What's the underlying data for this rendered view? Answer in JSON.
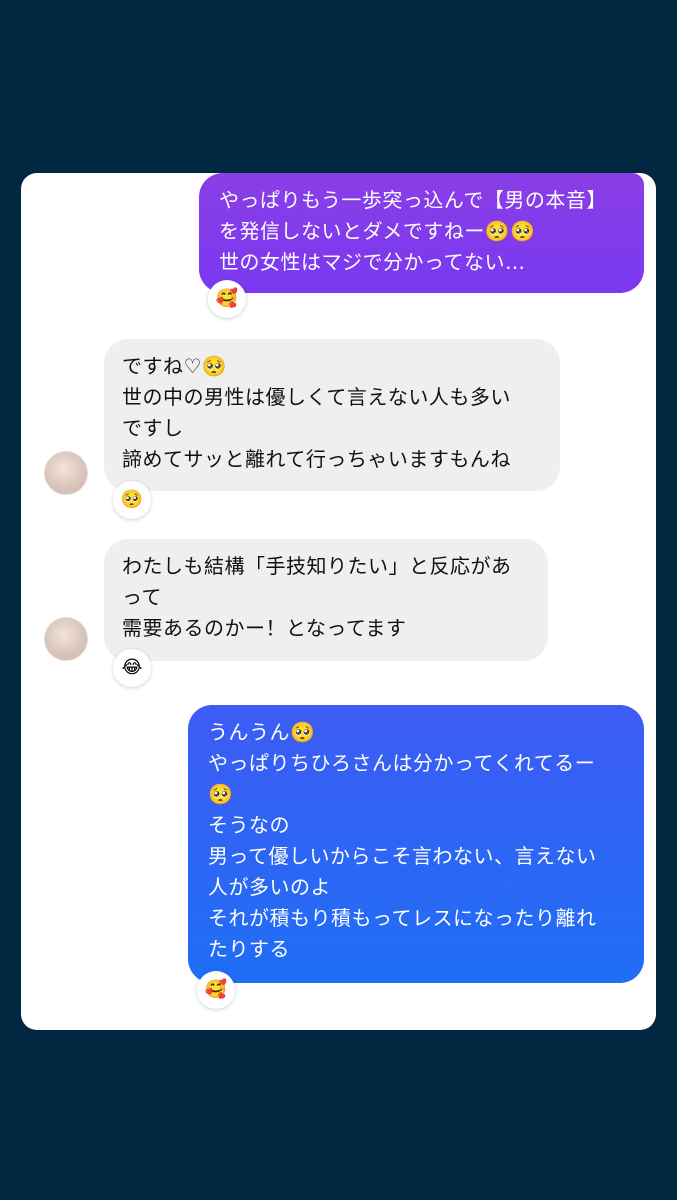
{
  "messages": [
    {
      "direction": "outgoing",
      "text": "やっぱりもう一歩突っ込んで【男の本音】\nを発信しないとダメですねー🥺🥺\n世の女性はマジで分かってない…",
      "reaction": "🥰",
      "color_top": "#8a3fe6",
      "color_bottom": "#7a38f0"
    },
    {
      "direction": "incoming",
      "text": "ですね♡🥺\n世の中の男性は優しくて言えない人も多い\nですし\n諦めてサッと離れて行っちゃいますもんね",
      "reaction": "🥺"
    },
    {
      "direction": "incoming",
      "text": "わたしも結構「手技知りたい」と反応があ\nって\n需要あるのかー！となってます",
      "reaction": "😂"
    },
    {
      "direction": "outgoing",
      "text": "うんうん🥺\nやっぱりちひろさんは分かってくれてるー\n🥺\nそうなの\n男って優しいからこそ言わない、言えない\n人が多いのよ\nそれが積もり積もってレスになったり離れ\nたりする",
      "reaction": "🥰",
      "color_top": "#3d5cf5",
      "color_bottom": "#1f6ef5"
    }
  ],
  "colors": {
    "background": "#022741",
    "card": "#ffffff",
    "incoming_bubble": "#efefef"
  }
}
